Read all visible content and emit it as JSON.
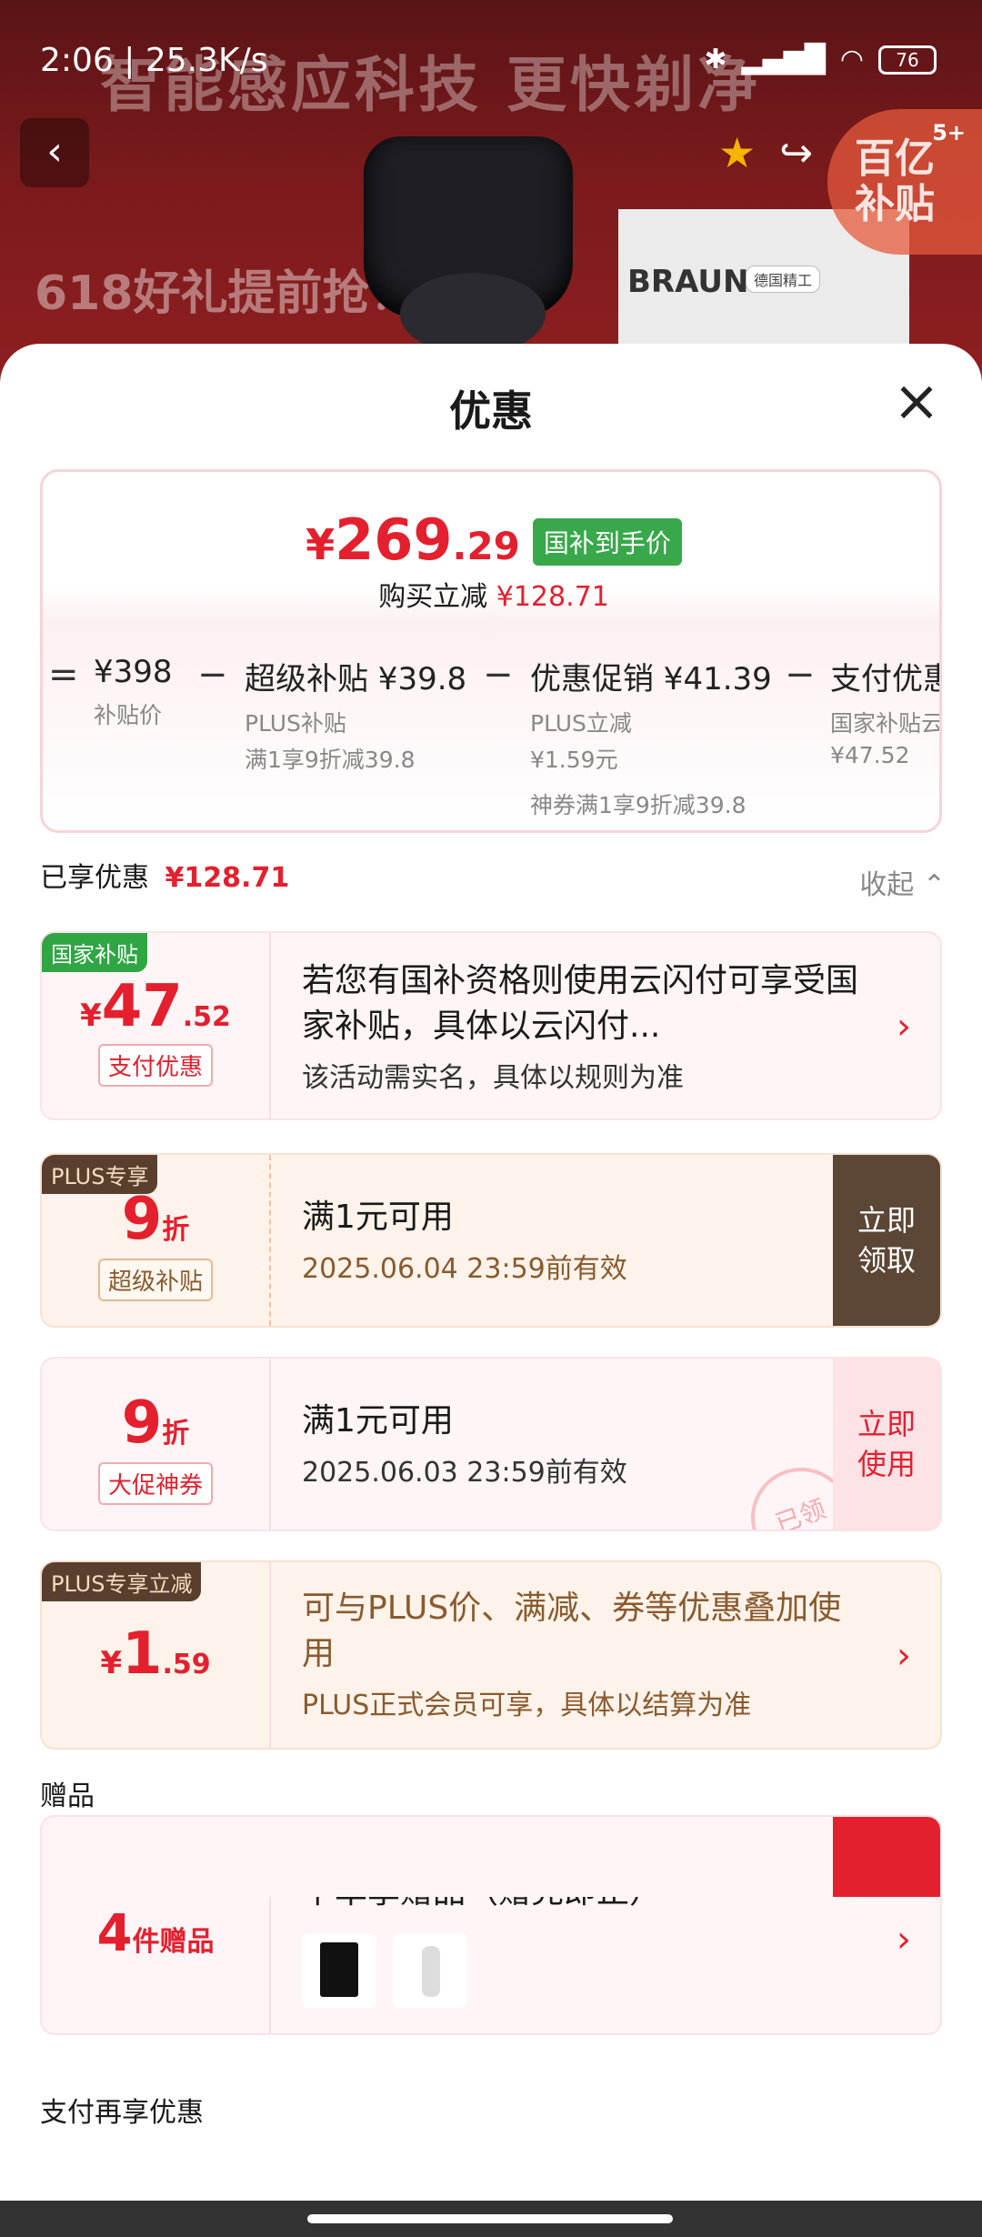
{
  "status_bar": {
    "time": "2:06 | 25.3K/s",
    "battery": "76"
  },
  "background": {
    "slogan": "智能感应科技  更快剃净",
    "promo": "618好礼提前抢！",
    "brand": "BRAUN",
    "box_badge": "德国精工"
  },
  "nav": {
    "subsidy_badge": "百亿\n补贴",
    "subsidy_count": "5+"
  },
  "sheet": {
    "title": "优惠"
  },
  "price_box": {
    "currency": "¥",
    "final_int": "269",
    "final_dec": ".29",
    "tag": "国补到手价",
    "sub_label": "购买立减",
    "sub_value": "¥128.71",
    "breakdown": [
      {
        "op": "=",
        "head": "¥398",
        "lines": [
          "补贴价"
        ]
      },
      {
        "op": "−",
        "head": "超级补贴 ¥39.8",
        "lines": [
          "PLUS补贴",
          "满1享9折减39.8"
        ]
      },
      {
        "op": "−",
        "head": "优惠促销 ¥41.39",
        "lines": [
          "PLUS立减",
          "¥1.59元",
          "神券满1享9折减39.8"
        ]
      },
      {
        "op": "−",
        "head": "支付优惠",
        "lines": [
          "国家补贴云",
          "¥47.52"
        ]
      }
    ]
  },
  "enjoyed": {
    "label": "已享优惠",
    "value": "¥128.71",
    "collapse": "收起"
  },
  "coupons": [
    {
      "corner": "国家补贴",
      "cur": "¥",
      "big": "47",
      "small": ".52",
      "badge": "支付优惠",
      "title": "若您有国补资格则使用云闪付可享受国家补贴，具体以云闪付...",
      "sub": "该活动需实名，具体以规则为准"
    },
    {
      "corner": "PLUS专享",
      "big": "9",
      "small": "折",
      "badge": "超级补贴",
      "title": "满1元可用",
      "sub": "2025.06.04 23:59前有效",
      "button": "立即\n领取"
    },
    {
      "big": "9",
      "small": "折",
      "badge": "大促神券",
      "title": "满1元可用",
      "sub": "2025.06.03 23:59前有效",
      "button": "立即\n使用",
      "stamp": "已领"
    },
    {
      "corner": "PLUS专享立减",
      "cur": "¥",
      "big": "1",
      "small": ".59",
      "title": "可与PLUS价、满减、券等优惠叠加使用",
      "sub": "PLUS正式会员可享，具体以结算为准"
    }
  ],
  "gifts": {
    "section_label": "赠品",
    "count": "4",
    "unit": "件赠品",
    "title": "下单享赠品（赠完即止）"
  },
  "pay_more": {
    "section_label": "支付再享优惠"
  },
  "colors": {
    "accent": "#e4202e",
    "green": "#38a84a",
    "plus_brown": "#5c4636"
  }
}
